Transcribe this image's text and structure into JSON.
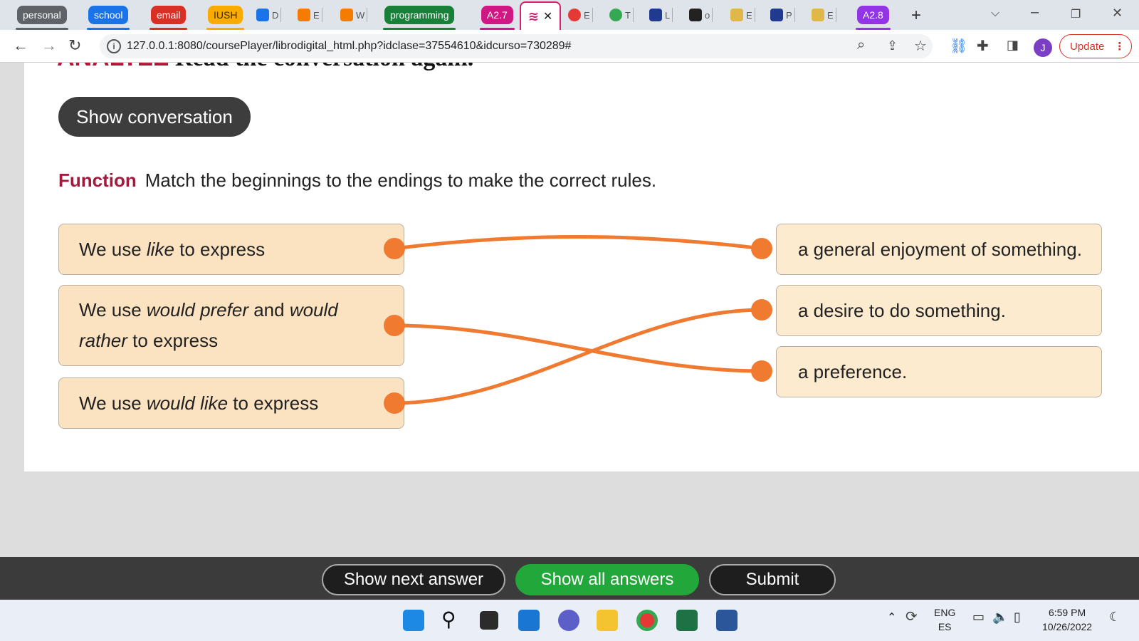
{
  "browser": {
    "tab_groups": [
      {
        "label": "personal",
        "color": "#5f6368"
      },
      {
        "label": "school",
        "color": "#1a73e8"
      },
      {
        "label": "email",
        "color": "#d93025"
      },
      {
        "label": "IUSH",
        "color": "#f9ab00"
      },
      {
        "label": "programming",
        "color": "#188038"
      },
      {
        "label": "A2.7",
        "color": "#d01884"
      },
      {
        "label": "A2.8",
        "color": "#9334e6"
      }
    ],
    "mini_tabs": [
      "D",
      "E",
      "W",
      "E",
      "T",
      "L",
      "o",
      "E",
      "P",
      "E"
    ],
    "url": "127.0.0.1:8080/coursePlayer/librodigital_html.php?idclase=37554610&idcurso=730289#",
    "update_label": "Update",
    "profile_initial": "J"
  },
  "page": {
    "heading_keyword": "ANALYZE",
    "heading_text": "Read the conversation again.",
    "show_conversation_label": "Show conversation",
    "function_label": "Function",
    "instruction": "Match the beginnings to the endings to make the correct rules.",
    "left_items": [
      {
        "pre": "We use ",
        "em": "like",
        "mid": " to express",
        "em2": "",
        "post": ""
      },
      {
        "pre": "We use ",
        "em": "would prefer",
        "mid": " and ",
        "em2": "would rather",
        "post": " to express"
      },
      {
        "pre": "We use ",
        "em": "would like",
        "mid": " to express",
        "em2": "",
        "post": ""
      }
    ],
    "right_items": [
      "a general enjoyment of something.",
      "a desire to do something.",
      "a preference."
    ],
    "matches": [
      [
        0,
        0
      ],
      [
        1,
        2
      ],
      [
        2,
        1
      ]
    ],
    "line_color": "#ef7a30"
  },
  "actions": {
    "show_next_label": "Show next answer",
    "show_all_label": "Show all answers",
    "submit_label": "Submit"
  },
  "taskbar": {
    "lang_1": "ENG",
    "lang_2": "ES",
    "time": "6:59 PM",
    "date": "10/26/2022"
  }
}
